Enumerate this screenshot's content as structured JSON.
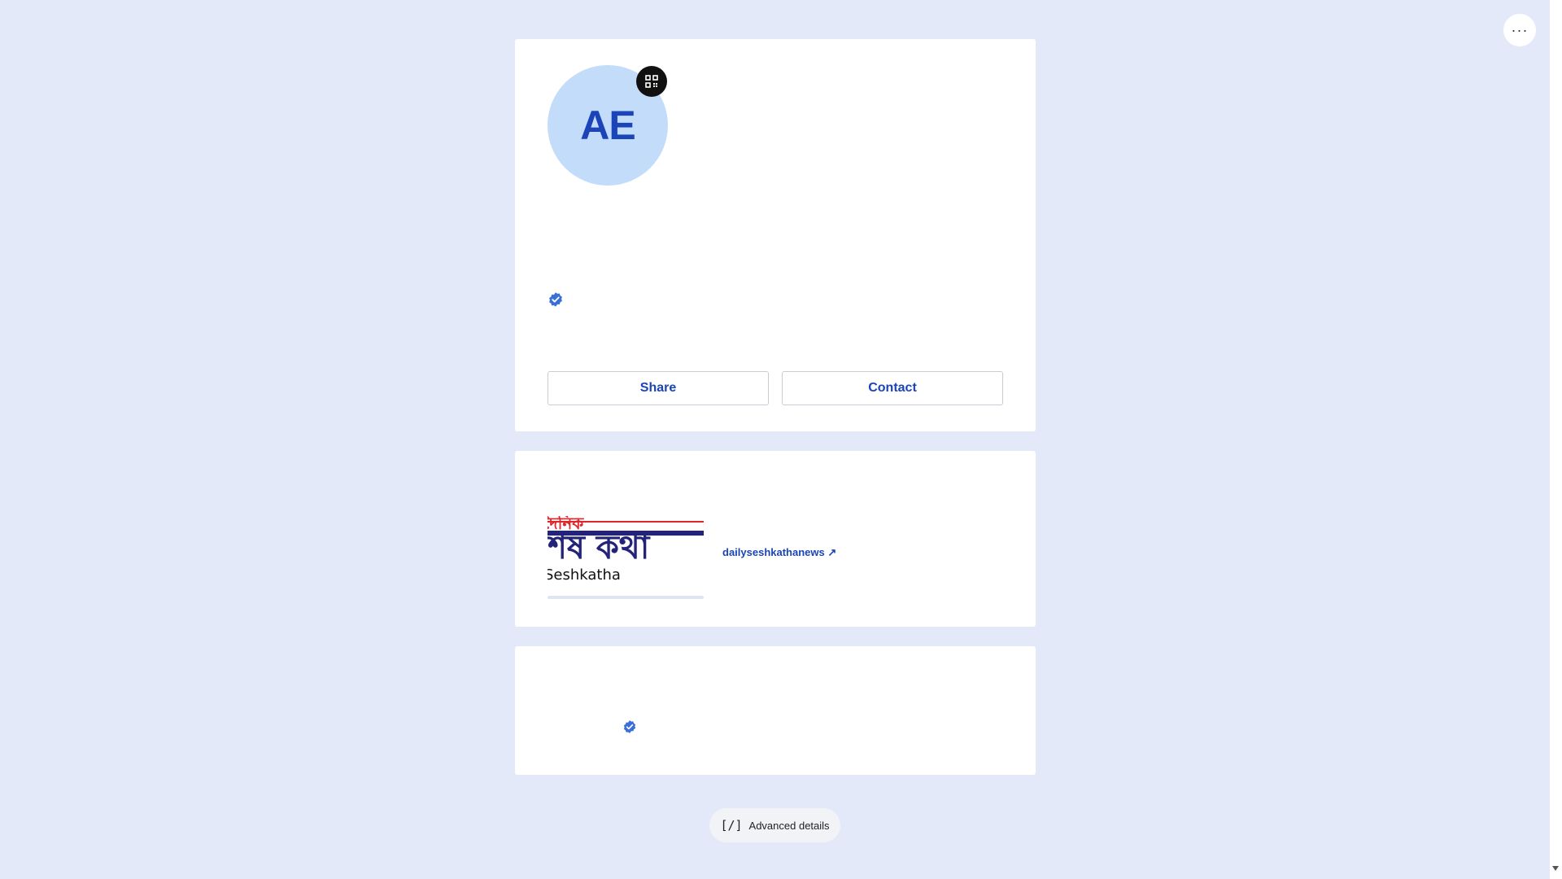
{
  "header": {
    "more_icon": "ellipsis-icon",
    "more_label": "···"
  },
  "profile": {
    "initials": "AE",
    "qr_icon": "qr-code-icon",
    "verified_icon": "verified-badge-icon",
    "buttons": {
      "share_label": "Share",
      "contact_label": "Contact"
    }
  },
  "links": {
    "items": [
      {
        "label": "dailyseshkathanews ↗",
        "image_caption": "Seshkatha",
        "image_bengali_top": "দৈনিক",
        "image_bengali_main": "শেষ কথা"
      }
    ]
  },
  "verification": {
    "verified_icon": "verified-badge-icon"
  },
  "footer": {
    "advanced_icon": "[/]",
    "advanced_label": "Advanced details"
  },
  "colors": {
    "background": "#e3e9f9",
    "accent": "#1a44b8",
    "avatar_bg": "#c3dcfa",
    "verified": "#3a6fd8",
    "logo_red": "#e0262b",
    "logo_navy": "#23237a"
  }
}
